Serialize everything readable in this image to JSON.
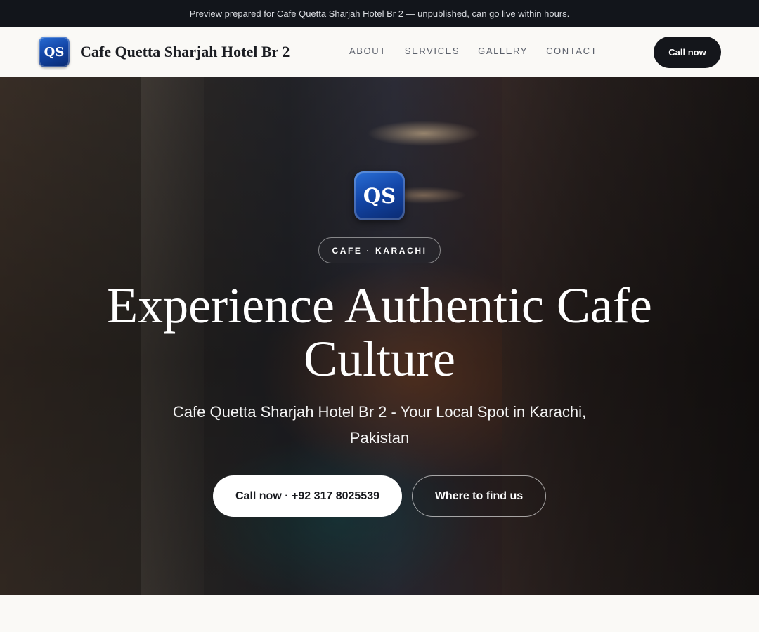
{
  "preview_bar": {
    "text": "Preview prepared for Cafe Quetta Sharjah Hotel Br 2 — unpublished, can go live within hours."
  },
  "header": {
    "logo_text": "QS",
    "brand_name": "Cafe Quetta Sharjah Hotel Br 2",
    "nav": [
      "ABOUT",
      "SERVICES",
      "GALLERY",
      "CONTACT"
    ],
    "call_label": "Call now"
  },
  "hero": {
    "logo_text": "QS",
    "badge": "CAFE · KARACHI",
    "title": "Experience Authentic Cafe Culture",
    "subtitle": "Cafe Quetta Sharjah Hotel Br 2 - Your Local Spot in Karachi, Pakistan",
    "primary_cta": "Call now · +92 317 8025539",
    "secondary_cta": "Where to find us"
  },
  "colors": {
    "preview_bar_bg": "#12151b",
    "header_bg": "#faf9f6",
    "call_button_bg": "#14161b",
    "logo_blue": "#1346a8"
  }
}
